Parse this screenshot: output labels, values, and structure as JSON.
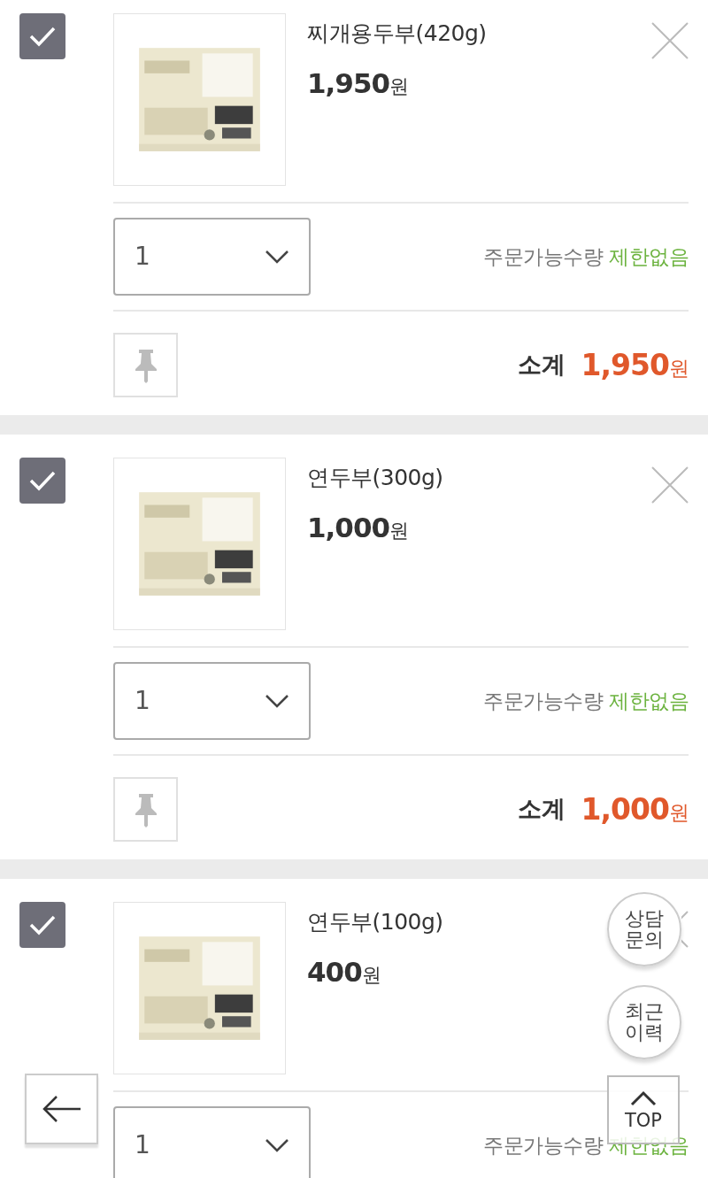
{
  "cart_items": [
    {
      "checked": true,
      "name": "찌개용두부(420g)",
      "price": "1,950",
      "price_unit": "원",
      "quantity": "1",
      "limit_label": "주문가능수량",
      "limit_value": "제한없음",
      "subtotal_label": "소계",
      "subtotal": "1,950",
      "subtotal_unit": "원"
    },
    {
      "checked": true,
      "name": "연두부(300g)",
      "price": "1,000",
      "price_unit": "원",
      "quantity": "1",
      "limit_label": "주문가능수량",
      "limit_value": "제한없음",
      "subtotal_label": "소계",
      "subtotal": "1,000",
      "subtotal_unit": "원"
    },
    {
      "checked": true,
      "name": "연두부(100g)",
      "price": "400",
      "price_unit": "원",
      "quantity": "1",
      "limit_label": "주문가능수량",
      "limit_value": "제한없음"
    }
  ],
  "floating_buttons": [
    {
      "kind": "round",
      "label": "상담문의"
    },
    {
      "kind": "round",
      "label": "최근이력"
    },
    {
      "kind": "top",
      "label": "TOP"
    }
  ]
}
